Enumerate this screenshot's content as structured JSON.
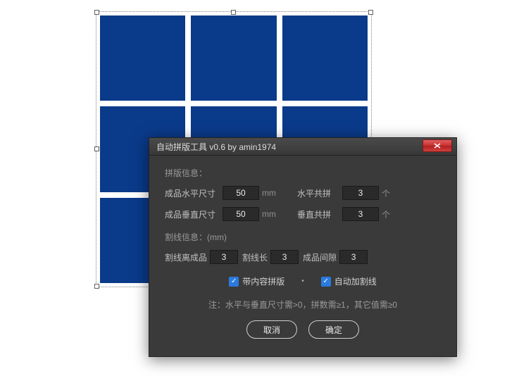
{
  "dialog": {
    "title": "自动拼版工具 v0.6   by amin1974",
    "section1_title": "拼版信息：",
    "row1": {
      "label": "成品水平尺寸",
      "value": "50",
      "unit": "mm",
      "label2": "水平共拼",
      "value2": "3",
      "unit2": "个"
    },
    "row2": {
      "label": "成品垂直尺寸",
      "value": "50",
      "unit": "mm",
      "label2": "垂直共拼",
      "value2": "3",
      "unit2": "个"
    },
    "section2_title": "割线信息：(mm)",
    "cut": {
      "label1": "割线离成品",
      "value1": "3",
      "label2": "割线长",
      "value2": "3",
      "label3": "成品间隙",
      "value3": "3"
    },
    "chk1_label": "带内容拼版",
    "chk2_label": "自动加割线",
    "note": "注：水平与垂直尺寸需>0，拼数需≥1，其它值需≥0",
    "cancel": "取消",
    "ok": "确定"
  }
}
